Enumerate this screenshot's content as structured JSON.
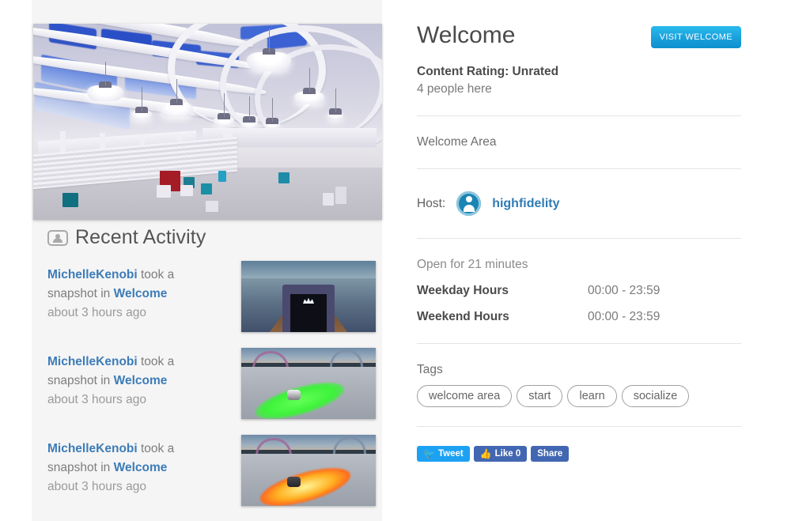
{
  "left": {
    "hero_image": {
      "name": "welcome-area-hall-screenshot",
      "alt": "Large white arched hall with glass ceiling, pendant lights and colored cubes"
    },
    "activity": {
      "heading": "Recent Activity",
      "icon": "user-card-icon",
      "items": [
        {
          "user": "MichelleKenobi",
          "action_before": " took a snapshot in ",
          "place": "Welcome",
          "time": "about 3 hours ago",
          "thumb": "bowling-lane-snapshot"
        },
        {
          "user": "MichelleKenobi",
          "action_before": " took a snapshot in ",
          "place": "Welcome",
          "time": "about 3 hours ago",
          "thumb": "green-glow-plaza-snapshot"
        },
        {
          "user": "MichelleKenobi",
          "action_before": " took a snapshot in ",
          "place": "Welcome",
          "time": "about 3 hours ago",
          "thumb": "orange-glow-plaza-snapshot"
        }
      ]
    }
  },
  "right": {
    "title": "Welcome",
    "visit_button": "VISIT WELCOME",
    "content_rating": "Content Rating: Unrated",
    "people_here": "4 people here",
    "area_name": "Welcome Area",
    "host_label": "Host:",
    "host_name": "highfidelity",
    "host_avatar_icon": "user-circle-icon",
    "open_for": "Open for 21 minutes",
    "hours": [
      {
        "label": "Weekday Hours",
        "value": "00:00 - 23:59"
      },
      {
        "label": "Weekend Hours",
        "value": "00:00 - 23:59"
      }
    ],
    "tags_label": "Tags",
    "tags": [
      "welcome area",
      "start",
      "learn",
      "socialize"
    ],
    "social": [
      {
        "id": "tweet",
        "icon": "twitter-bird-icon",
        "label": "Tweet"
      },
      {
        "id": "like",
        "icon": "thumbs-up-icon",
        "label": "Like 0"
      },
      {
        "id": "share",
        "icon": "",
        "label": "Share"
      }
    ]
  },
  "colors": {
    "accent_blue": "#19a0db",
    "link_blue": "#3c7cb8",
    "host_blue": "#1985b4",
    "twitter_blue": "#1da1f2",
    "facebook_blue": "#4267b2",
    "panel_grey": "#f5f5f5"
  }
}
